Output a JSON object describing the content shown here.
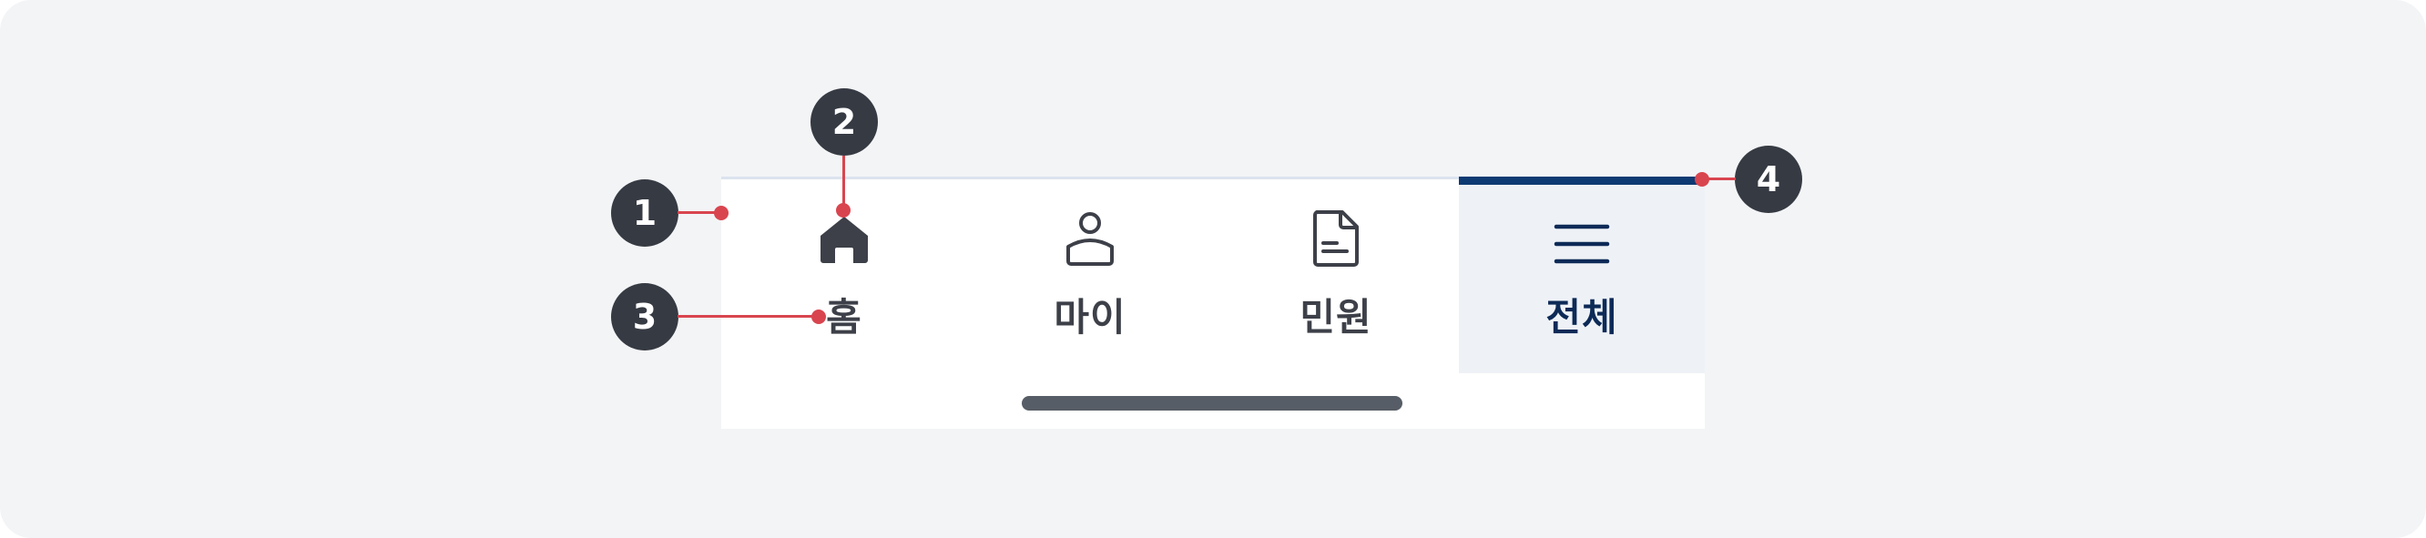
{
  "navbar": {
    "tabs": [
      {
        "label": "홈",
        "icon": "home-icon"
      },
      {
        "label": "마이",
        "icon": "person-icon"
      },
      {
        "label": "민원",
        "icon": "document-icon"
      },
      {
        "label": "전체",
        "icon": "menu-icon",
        "active": true
      }
    ]
  },
  "callouts": [
    "1",
    "2",
    "3",
    "4"
  ],
  "colors": {
    "active_indicator": "#0d3a73",
    "active_background": "#eef2f7",
    "callout": "#363a43",
    "leader_line": "#d9454f",
    "icon": "#3d4048"
  }
}
